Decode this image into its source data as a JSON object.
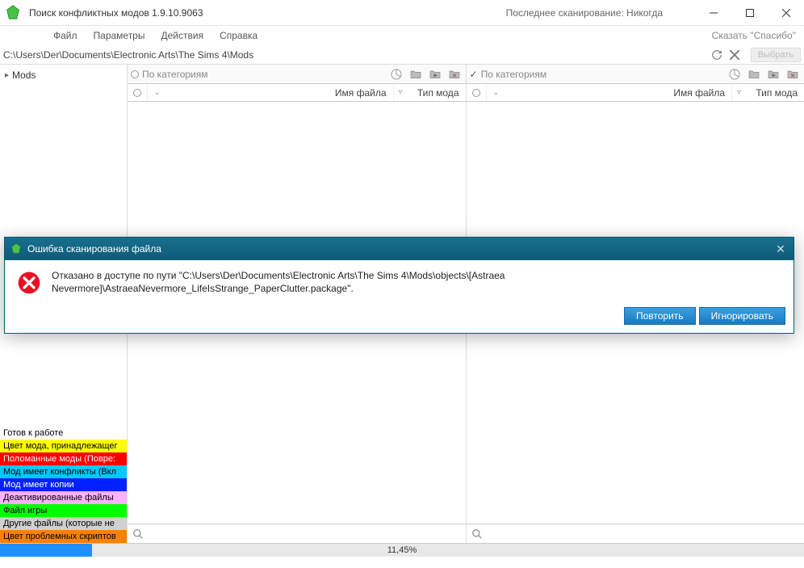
{
  "window": {
    "title": "Поиск конфликтных модов 1.9.10.9063",
    "last_scan": "Последнее сканирование: Никогда"
  },
  "menu": {
    "file": "Файл",
    "params": "Параметры",
    "actions": "Действия",
    "help": "Справка",
    "thanks": "Сказать \"Спасибо\""
  },
  "pathbar": {
    "path": "C:\\Users\\Der\\Documents\\Electronic Arts\\The Sims 4\\Mods",
    "select": "Выбрать"
  },
  "tree": {
    "root": "Mods"
  },
  "legend": [
    {
      "label": "Готов к работе",
      "bg": "#ffffff",
      "fg": "#000000"
    },
    {
      "label": "Цвет мода, принадлежащег",
      "bg": "#ffff00",
      "fg": "#000000"
    },
    {
      "label": "Поломанные моды (Повре:",
      "bg": "#ff0000",
      "fg": "#ffffff"
    },
    {
      "label": "Мод имеет конфликты (Вкл",
      "bg": "#00c8ff",
      "fg": "#000000"
    },
    {
      "label": "Мод имеет копии",
      "bg": "#0020ff",
      "fg": "#ffffff"
    },
    {
      "label": "Деактивированные файлы",
      "bg": "#ffb0ff",
      "fg": "#000000"
    },
    {
      "label": "Файл игры",
      "bg": "#00ff00",
      "fg": "#000000"
    },
    {
      "label": "Другие файлы (которые не",
      "bg": "#d0d0d0",
      "fg": "#000000"
    },
    {
      "label": "Цвет проблемных скриптов",
      "bg": "#ff8000",
      "fg": "#000000"
    }
  ],
  "panels": {
    "by_category": "По категориям",
    "col_filename": "Имя файла",
    "col_modtype": "Тип мода"
  },
  "progress": {
    "percent_text": "11,45%",
    "percent_value": 11.45
  },
  "dialog": {
    "title": "Ошибка сканирования файла",
    "message": "Отказано в доступе по пути \"C:\\Users\\Der\\Documents\\Electronic Arts\\The Sims 4\\Mods\\objects\\[Astraea Nevermore]\\AstraeaNevermore_LifeIsStrange_PaperClutter.package\".",
    "retry": "Повторить",
    "ignore": "Игнорировать"
  }
}
